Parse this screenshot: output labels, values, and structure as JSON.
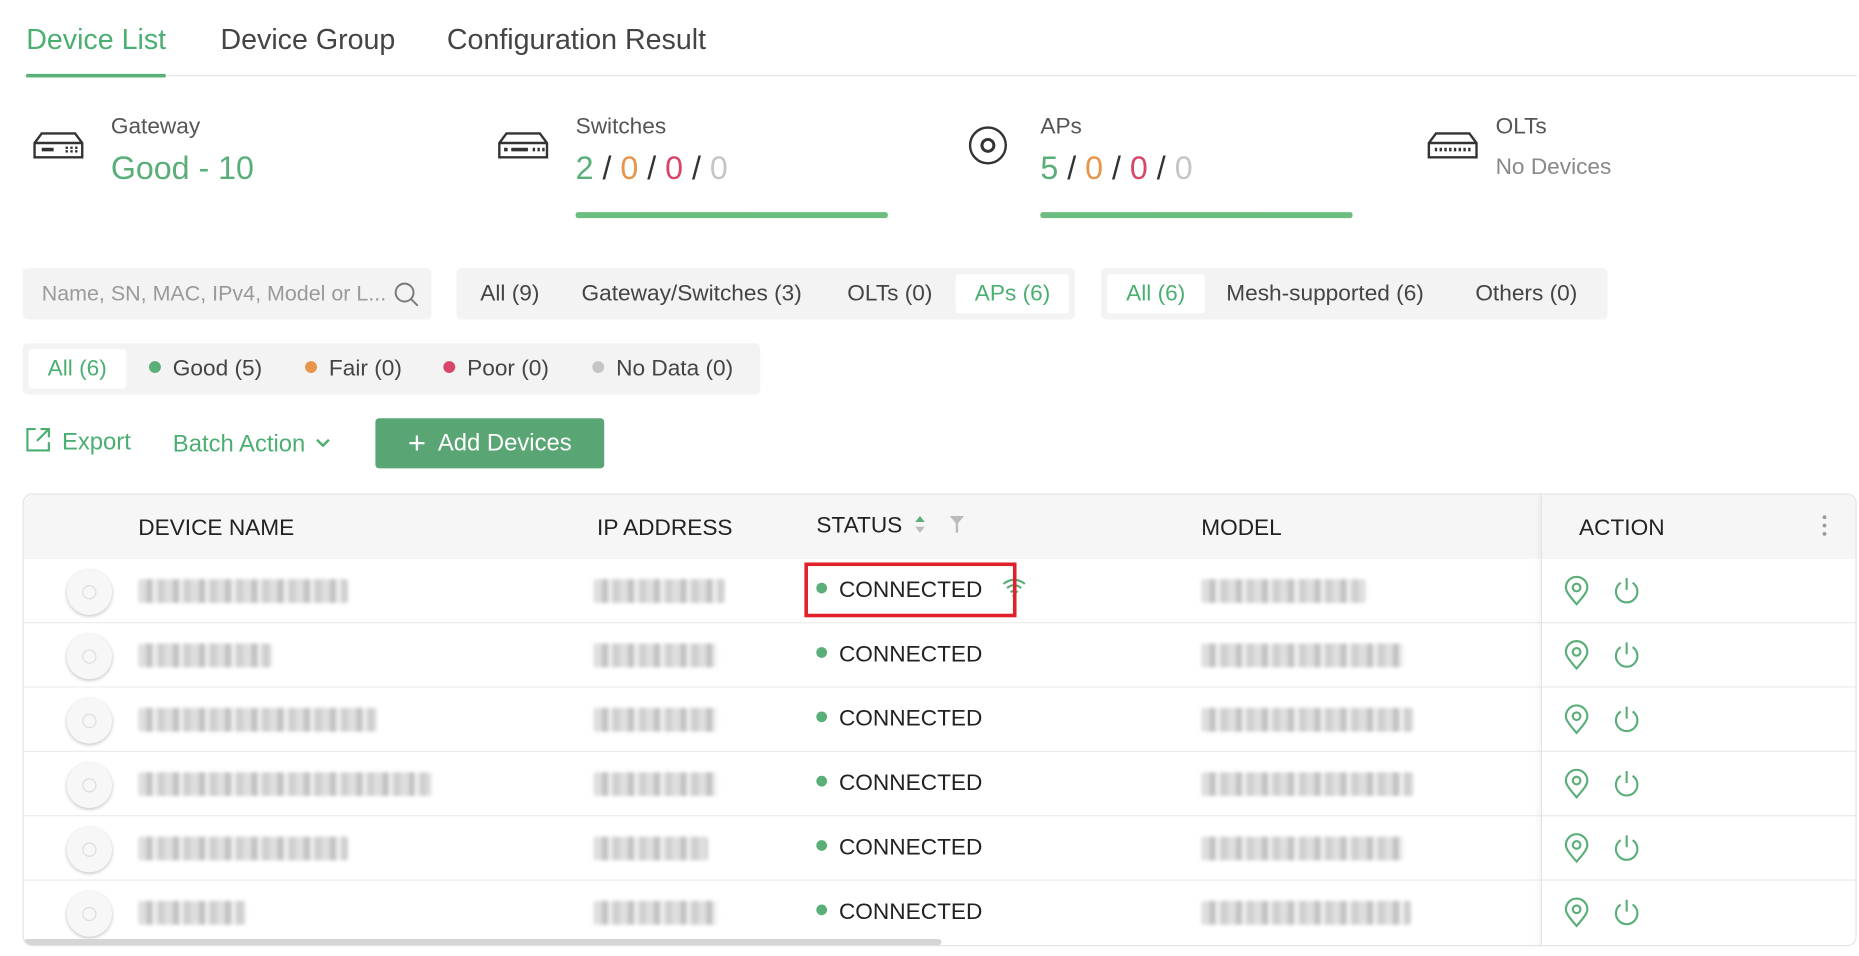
{
  "tabs": [
    {
      "label": "Device List",
      "active": true
    },
    {
      "label": "Device Group",
      "active": false
    },
    {
      "label": "Configuration Result",
      "active": false
    }
  ],
  "summary": {
    "gateway": {
      "label": "Gateway",
      "value": "Good - 10"
    },
    "switches": {
      "label": "Switches",
      "good": "2",
      "fair": "0",
      "poor": "0",
      "nodata": "0",
      "sep": "/"
    },
    "aps": {
      "label": "APs",
      "good": "5",
      "fair": "0",
      "poor": "0",
      "nodata": "0",
      "sep": "/"
    },
    "olts": {
      "label": "OLTs",
      "value": "No Devices"
    }
  },
  "search": {
    "placeholder": "Name, SN, MAC, IPv4, Model or L..."
  },
  "type_filter": [
    "All (9)",
    "Gateway/Switches (3)",
    "OLTs (0)",
    "APs (6)"
  ],
  "type_filter_selected": "APs (6)",
  "mesh_filter": [
    "All (6)",
    "Mesh-supported (6)",
    "Others (0)"
  ],
  "mesh_filter_selected": "All (6)",
  "health_filter": {
    "all": "All (6)",
    "good": "Good (5)",
    "fair": "Fair (0)",
    "poor": "Poor (0)",
    "nodata": "No Data (0)"
  },
  "actions": {
    "export": "Export",
    "batch": "Batch Action",
    "add": "Add Devices"
  },
  "table": {
    "columns": {
      "device_name": "DEVICE NAME",
      "ip": "IP ADDRESS",
      "status": "STATUS",
      "model": "MODEL",
      "action": "ACTION"
    },
    "rows": [
      {
        "status": "CONNECTED",
        "mesh_wifi": true
      },
      {
        "status": "CONNECTED",
        "mesh_wifi": false
      },
      {
        "status": "CONNECTED",
        "mesh_wifi": false
      },
      {
        "status": "CONNECTED",
        "mesh_wifi": false
      },
      {
        "status": "CONNECTED",
        "mesh_wifi": false
      },
      {
        "status": "CONNECTED",
        "mesh_wifi": false
      }
    ]
  },
  "colors": {
    "accent": "#5aae78",
    "fair": "#e8944a",
    "poor": "#d8456a",
    "nodata": "#c5c5c5",
    "highlight": "#e0212a"
  }
}
